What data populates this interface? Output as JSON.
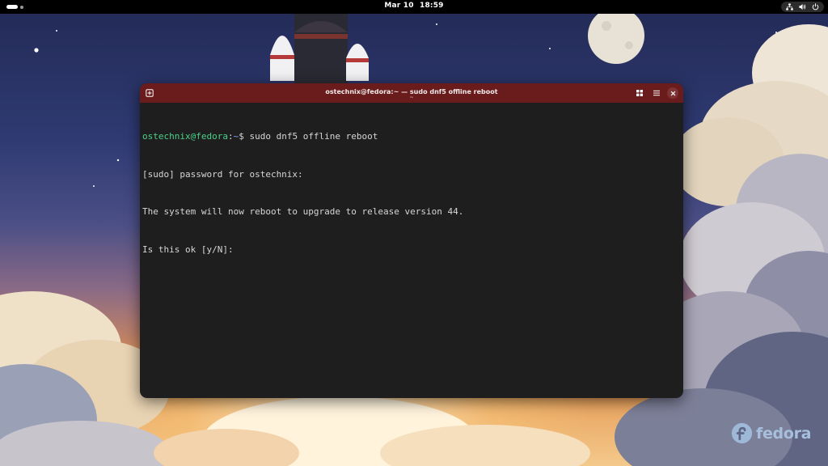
{
  "top_bar": {
    "date": "Mar 10",
    "time": "18:59",
    "icons": [
      "network-icon",
      "volume-icon",
      "power-icon"
    ]
  },
  "terminal": {
    "title": "ostechnix@fedora:~ — sudo dnf5 offline reboot",
    "subtitle": "~",
    "header_color": "#6a1c1d",
    "prompt_user": "ostechnix@fedora",
    "prompt_sep": ":",
    "prompt_path": "~",
    "prompt_symbol": "$",
    "command": " sudo dnf5 offline reboot",
    "output": [
      "[sudo] password for ostechnix:",
      "The system will now reboot to upgrade to release version 44.",
      "Is this ok [y/N]:"
    ]
  },
  "watermark": {
    "logo_text": "fedora"
  }
}
